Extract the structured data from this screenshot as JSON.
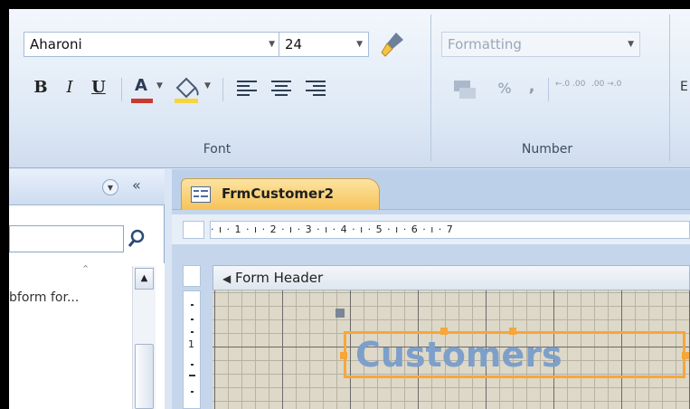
{
  "font_group": {
    "font_name": "Aharoni",
    "font_size": "24",
    "group_label": "Font",
    "bold_label": "B",
    "italic_label": "I",
    "underline_label": "U",
    "font_color_label": "A"
  },
  "number_group": {
    "format_value": "Formatting",
    "percent_label": "%",
    "comma_label": ",",
    "increase_decimals": "←.0 .00",
    "decrease_decimals": ".00 →.0",
    "group_label": "Number",
    "next_group_partial": "E"
  },
  "nav_pane": {
    "list_item_1": "bform for..."
  },
  "document": {
    "tab_title": "FrmCustomer2",
    "ruler_text": "· ı · 1 · ı · 2 · ı · 3 · ı · 4 · ı · 5 · ı · 6 · ı · 7",
    "section_header": "Form Header",
    "vruler_mark": "1",
    "title_label": "Customers"
  },
  "colors": {
    "accent_orange": "#f7a63a",
    "label_text": "#7d9fca",
    "tab_active": "#f6c35a"
  }
}
